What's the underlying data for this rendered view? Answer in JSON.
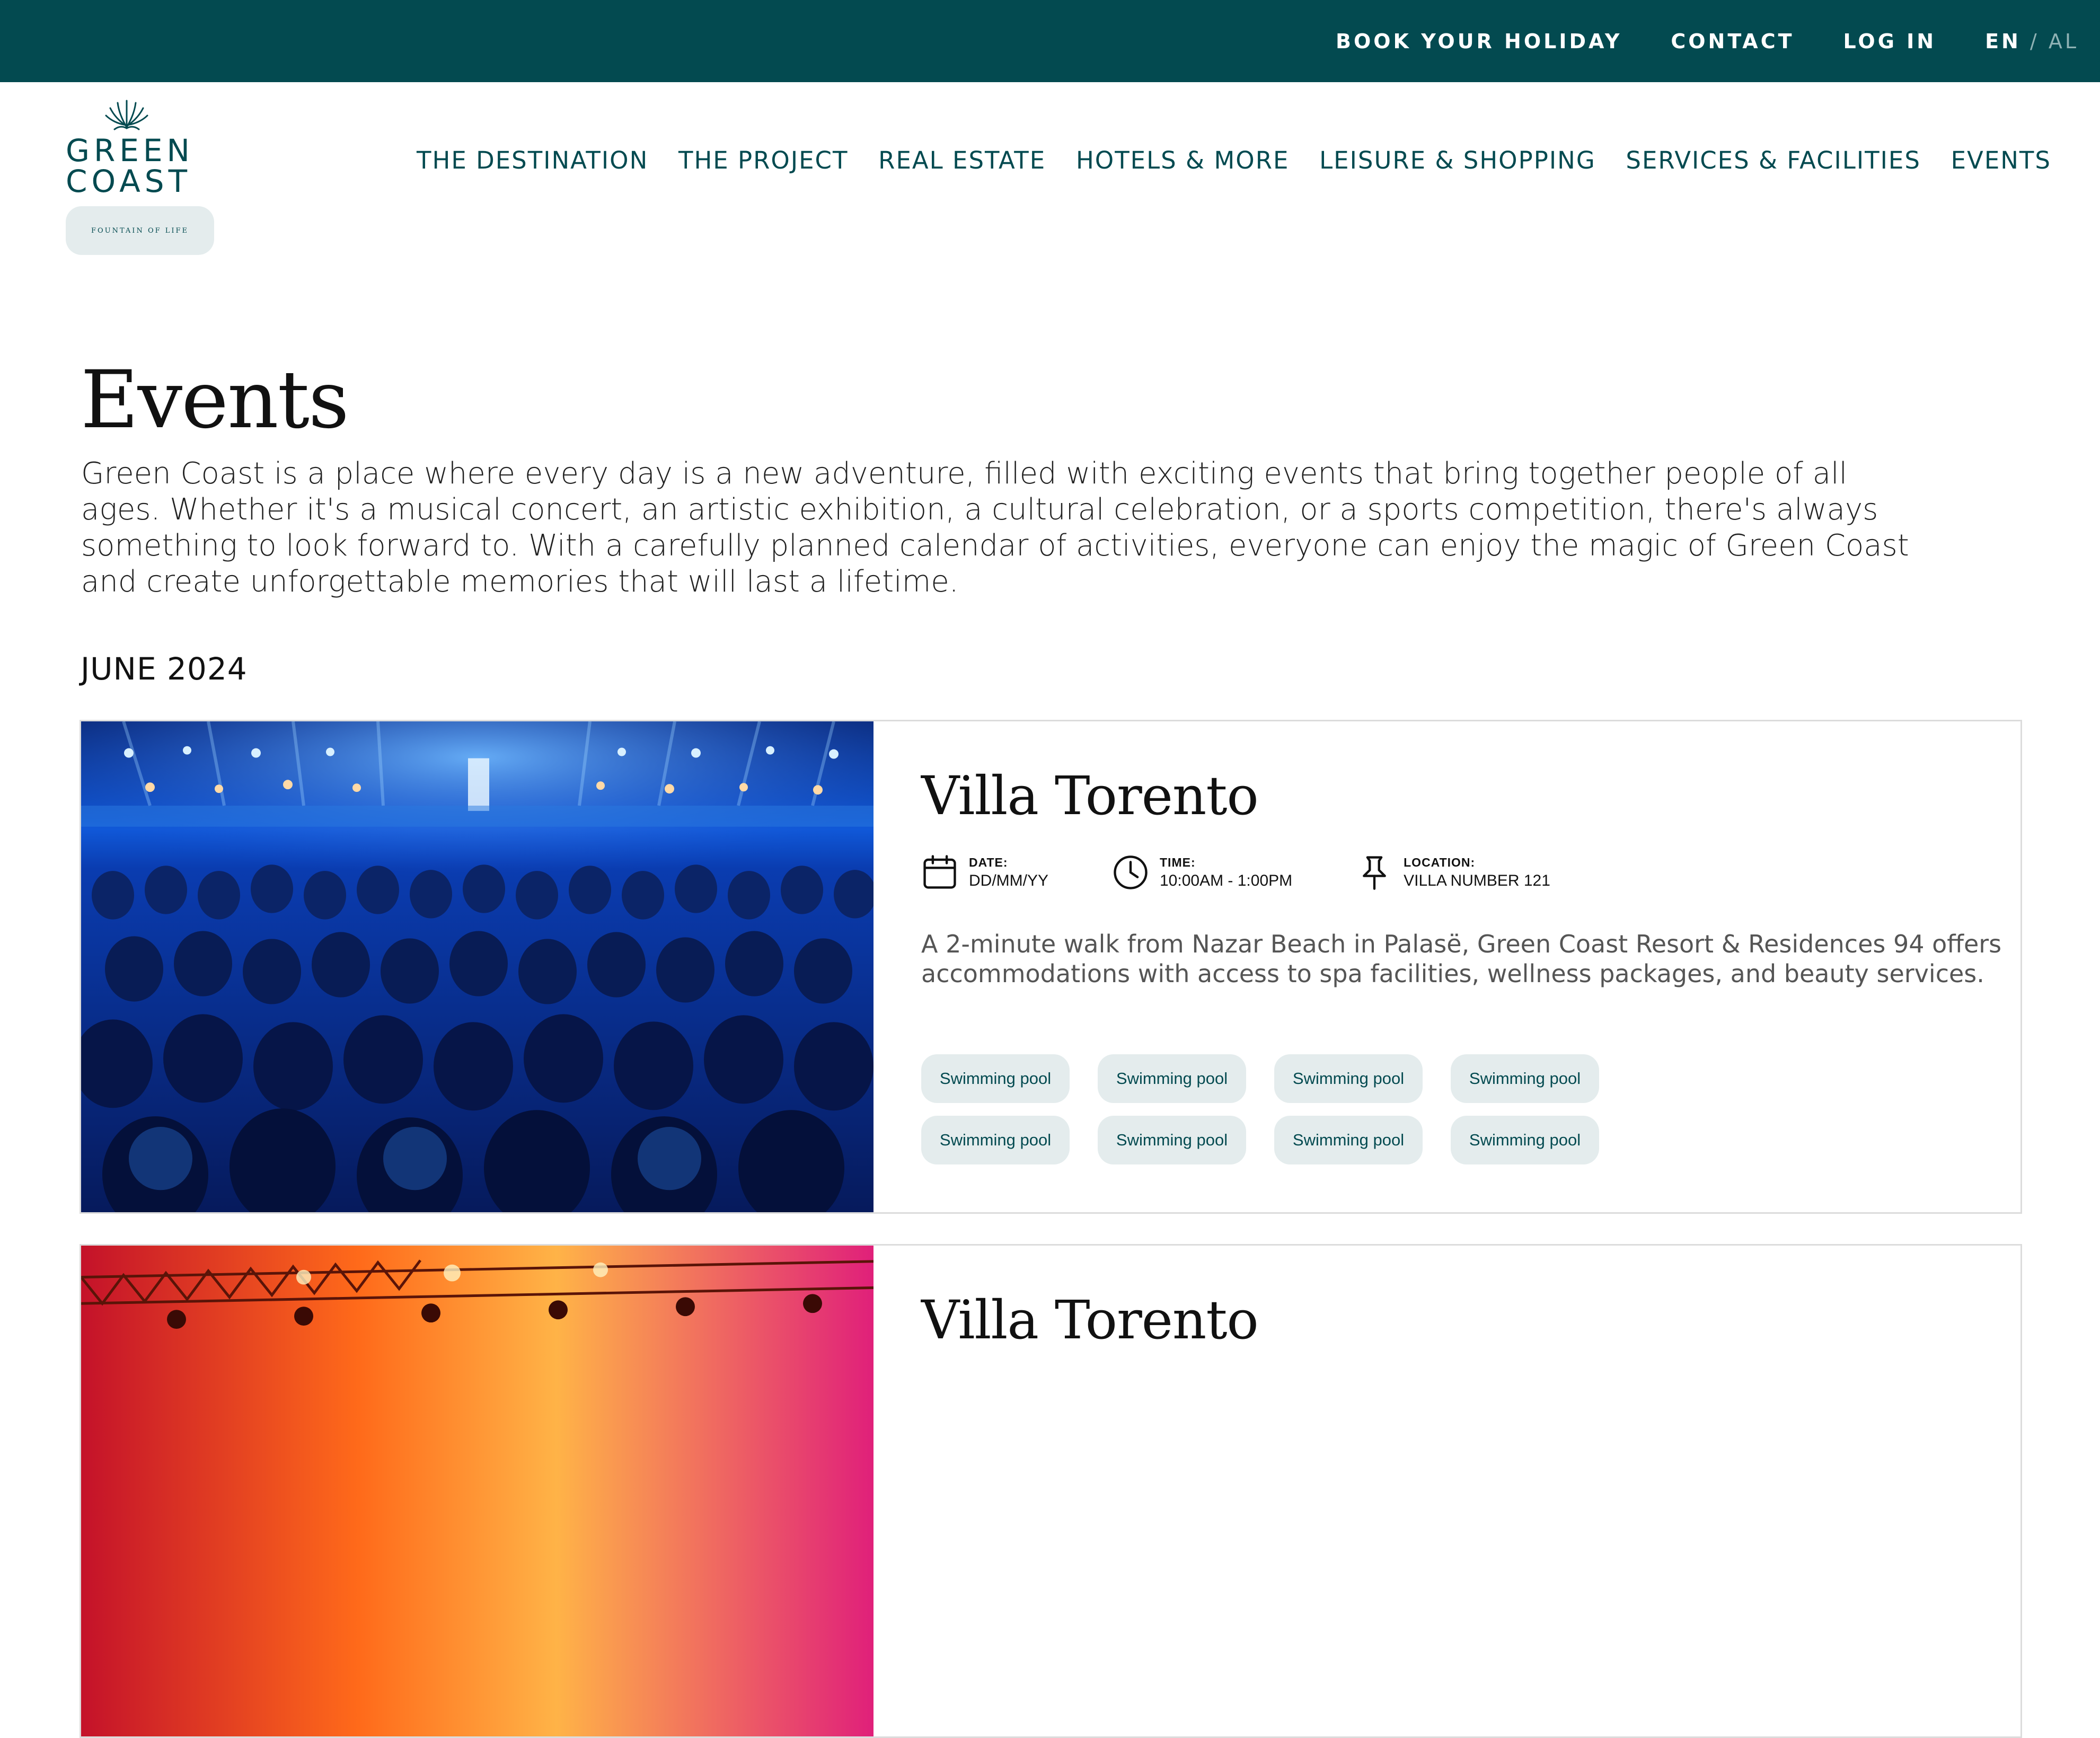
{
  "colors": {
    "brand": "#034a50",
    "tag_bg": "#e4eced",
    "tag_text": "#034a50"
  },
  "topbar": {
    "links": [
      "BOOK YOUR HOLIDAY",
      "CONTACT",
      "LOG IN"
    ],
    "lang_active": "EN",
    "lang_sep": "/",
    "lang_inactive": "AL"
  },
  "logo": {
    "line1": "GREEN",
    "line2": "COAST",
    "tagline": "FOUNTAIN OF LIFE"
  },
  "nav": [
    "THE DESTINATION",
    "THE PROJECT",
    "REAL ESTATE",
    "HOTELS & MORE",
    "LEISURE & SHOPPING",
    "SERVICES & FACILITIES",
    "EVENTS"
  ],
  "page": {
    "title": "Events",
    "intro": "Green Coast is a place where every day is a new adventure, filled with exciting events that bring together people of all ages. Whether it's a musical concert, an artistic exhibition, a cultural celebration, or a sports competition, there's always something to look forward to. With a carefully planned calendar of activities, everyone can enjoy the magic of Green Coast and create unforgettable memories that will last a lifetime.",
    "month": "JUNE 2024"
  },
  "events": [
    {
      "name": "Villa Torento",
      "date_label": "DATE:",
      "date": "DD/MM/YY",
      "time_label": "TIME:",
      "time": "10:00AM - 1:00PM",
      "location_label": "LOCATION:",
      "location": "VILLA NUMBER 121",
      "description": "A 2-minute walk from Nazar Beach in Palasë, Green Coast Resort & Residences 94 offers accommodations with access to spa facilities, wellness packages, and beauty services.",
      "tags": [
        "Swimming pool",
        "Swimming pool",
        "Swimming pool",
        "Swimming pool",
        "Swimming pool",
        "Swimming pool",
        "Swimming pool",
        "Swimming pool"
      ],
      "image": "concert-crowd-blue"
    },
    {
      "name": "Villa Torento",
      "image": "stage-lights-orange"
    }
  ]
}
